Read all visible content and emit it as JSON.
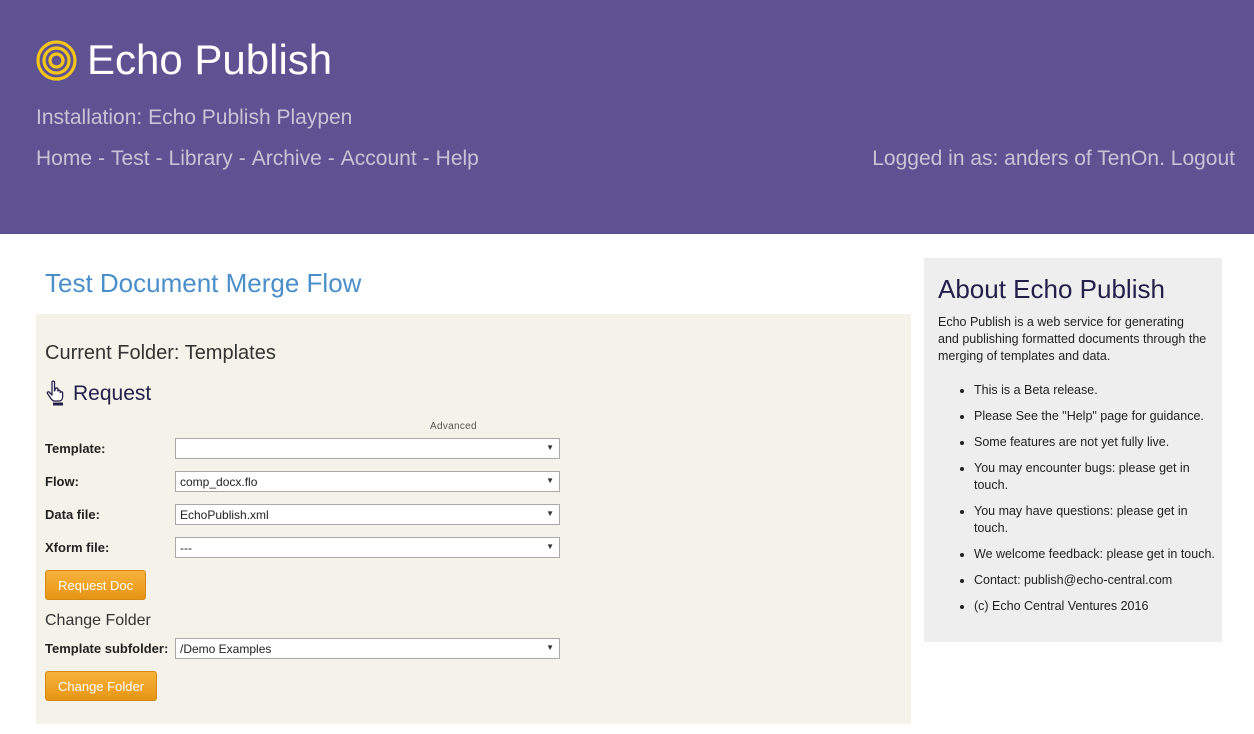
{
  "header": {
    "app_title": "Echo Publish",
    "installation": "Installation: Echo Publish Playpen",
    "nav": [
      {
        "label": "Home"
      },
      {
        "label": "Test"
      },
      {
        "label": "Library"
      },
      {
        "label": "Archive"
      },
      {
        "label": "Account"
      },
      {
        "label": "Help"
      }
    ],
    "nav_separator": "-",
    "login_text": "Logged in as: anders of TenOn.",
    "logout_label": "Logout",
    "logo_icon": "concentric-circles-icon",
    "logo_color": "#f5c518",
    "background_color": "#5f5292"
  },
  "main": {
    "page_title": "Test Document Merge Flow",
    "current_folder": "Current Folder: Templates",
    "request_icon": "pointing-hand-icon",
    "request_label": "Request",
    "advanced_label": "Advanced",
    "form": {
      "template": {
        "label": "Template:",
        "value": ""
      },
      "flow": {
        "label": "Flow:",
        "value": "comp_docx.flo"
      },
      "data_file": {
        "label": "Data file:",
        "value": "EchoPublish.xml"
      },
      "xform_file": {
        "label": "Xform file:",
        "value": "---"
      }
    },
    "request_button": "Request Doc",
    "change_folder_heading": "Change Folder",
    "subfolder": {
      "label": "Template subfolder:",
      "value": "/Demo Examples"
    },
    "change_folder_button": "Change Folder",
    "accent_color": "#4a8fca",
    "button_color": "#f0a024"
  },
  "sidebar": {
    "title": "About Echo Publish",
    "description": "Echo Publish is a web service for generating and publishing formatted documents through the merging of templates and data.",
    "items": [
      "This is a Beta release.",
      "Please See the \"Help\" page for guidance.",
      "Some features are not yet fully live.",
      "You may encounter bugs: please get in touch.",
      "You may have questions: please get in touch.",
      "We welcome feedback: please get in touch.",
      "Contact: publish@echo-central.com",
      "(c) Echo Central Ventures 2016"
    ]
  }
}
